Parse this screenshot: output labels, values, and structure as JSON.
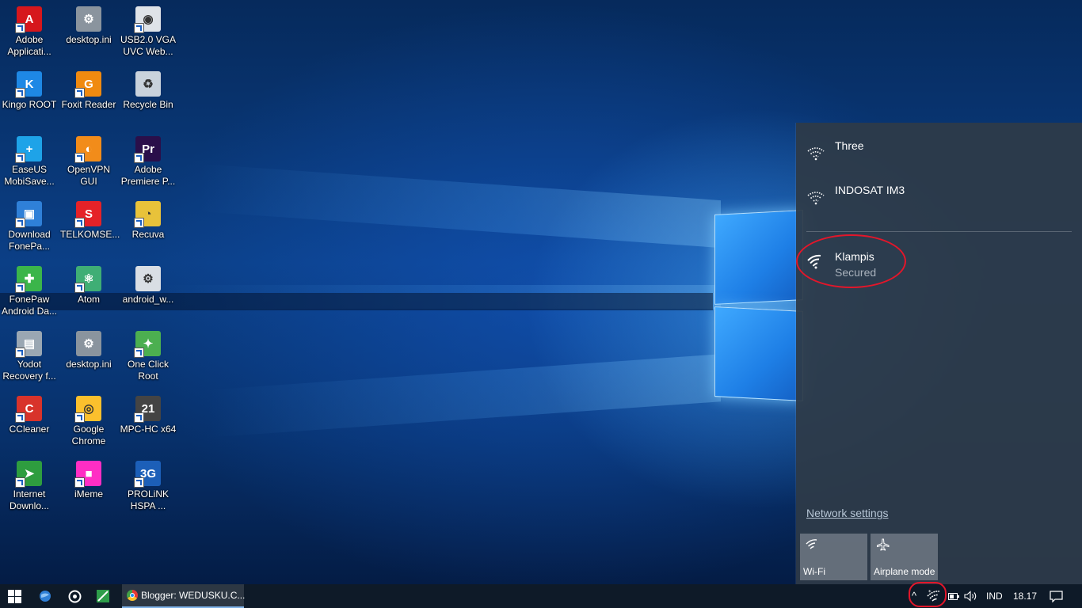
{
  "desktop": {
    "icons": [
      {
        "label": "Adobe Applicati...",
        "icon": "adobe-application-manager-icon",
        "color": "#d6171c",
        "glyph": "A"
      },
      {
        "label": "desktop.ini",
        "icon": "settings-file-icon",
        "color": "#8a949e",
        "glyph": "⚙"
      },
      {
        "label": "USB2.0 VGA UVC Web...",
        "icon": "webcam-icon",
        "color": "#dfe3e8",
        "glyph": "◉"
      },
      {
        "label": "Kingo ROOT",
        "icon": "kingo-root-icon",
        "color": "#1e88e5",
        "glyph": "K"
      },
      {
        "label": "Foxit Reader",
        "icon": "foxit-reader-icon",
        "color": "#f08a10",
        "glyph": "G"
      },
      {
        "label": "Recycle Bin",
        "icon": "recycle-bin-icon",
        "color": "#c9d2dc",
        "glyph": "♻"
      },
      {
        "label": "EaseUS MobiSave...",
        "icon": "easeus-mobisaver-icon",
        "color": "#1ea3e8",
        "glyph": "+"
      },
      {
        "label": "OpenVPN GUI",
        "icon": "openvpn-icon",
        "color": "#f28c1a",
        "glyph": "◐"
      },
      {
        "label": "Adobe Premiere P...",
        "icon": "adobe-premiere-icon",
        "color": "#2a0f4a",
        "glyph": "Pr"
      },
      {
        "label": "Download FonePa...",
        "icon": "fonepaw-download-icon",
        "color": "#2f80d8",
        "glyph": "▣"
      },
      {
        "label": "TELKOMSE...",
        "icon": "telkomsel-icon",
        "color": "#e52228",
        "glyph": "S"
      },
      {
        "label": "Recuva",
        "icon": "recuva-icon",
        "color": "#e8c23a",
        "glyph": "◔"
      },
      {
        "label": "FonePaw Android Da...",
        "icon": "fonepaw-android-icon",
        "color": "#3bb54a",
        "glyph": "✚"
      },
      {
        "label": "Atom",
        "icon": "atom-icon",
        "color": "#3fae75",
        "glyph": "⚛"
      },
      {
        "label": "android_w...",
        "icon": "android-file-icon",
        "color": "#d9dee4",
        "glyph": "⚙"
      },
      {
        "label": "Yodot Recovery f...",
        "icon": "yodot-recovery-icon",
        "color": "#9aa7b3",
        "glyph": "▤"
      },
      {
        "label": "desktop.ini",
        "icon": "settings-file-icon",
        "color": "#8a949e",
        "glyph": "⚙"
      },
      {
        "label": "One Click Root",
        "icon": "one-click-root-icon",
        "color": "#4caf50",
        "glyph": "✦"
      },
      {
        "label": "CCleaner",
        "icon": "ccleaner-icon",
        "color": "#d8332b",
        "glyph": "C"
      },
      {
        "label": "Google Chrome",
        "icon": "chrome-icon",
        "color": "#fbc02d",
        "glyph": "◎"
      },
      {
        "label": "MPC-HC x64",
        "icon": "mpc-hc-icon",
        "color": "#444444",
        "glyph": "21"
      },
      {
        "label": "Internet Downlo...",
        "icon": "internet-download-manager-icon",
        "color": "#2e9d3f",
        "glyph": "➤"
      },
      {
        "label": "iMeme",
        "icon": "imeme-icon",
        "color": "#ff2ec4",
        "glyph": "■"
      },
      {
        "label": "PROLiNK HSPA ...",
        "icon": "prolink-hspa-icon",
        "color": "#1c5fb8",
        "glyph": "3G"
      }
    ]
  },
  "network_flyout": {
    "networks": [
      {
        "name": "Three",
        "status": ""
      },
      {
        "name": "INDOSAT IM3",
        "status": ""
      },
      {
        "name": "Klampis",
        "status": "Secured"
      }
    ],
    "settings_link": "Network settings",
    "tiles": [
      {
        "label": "Wi-Fi",
        "icon": "wifi-icon"
      },
      {
        "label": "Airplane mode",
        "icon": "airplane-icon"
      }
    ]
  },
  "taskbar": {
    "start_icon": "windows-logo-icon",
    "pinned": [
      {
        "icon": "browser-globe-icon"
      },
      {
        "icon": "media-disc-icon"
      },
      {
        "icon": "green-app-icon"
      }
    ],
    "open_app": {
      "icon": "chrome-icon",
      "label": "Blogger: WEDUSKU.C..."
    },
    "tray": {
      "chevron": "^",
      "language": "IND",
      "time": "18.17"
    }
  },
  "colors": {
    "flyout_bg": "#2e3a48",
    "highlight_circle": "#e3162a",
    "taskbar_bg": "#0e1a28"
  }
}
